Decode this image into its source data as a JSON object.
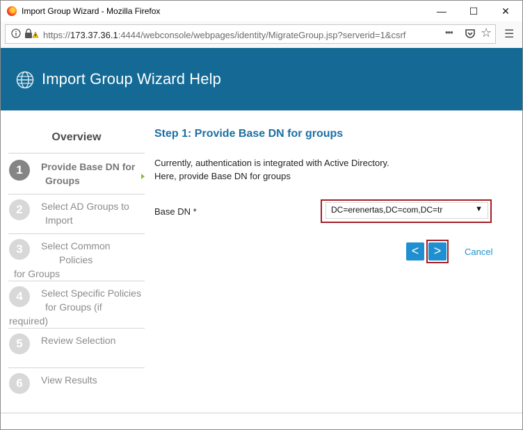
{
  "window": {
    "title": "Import Group Wizard - Mozilla Firefox",
    "controls": {
      "minimize": "—",
      "maximize": "☐",
      "close": "✕"
    }
  },
  "browser": {
    "url_prefix": "https://",
    "url_host": "173.37.36.1",
    "url_rest": ":4444/webconsole/webpages/identity/MigrateGroup.jsp?serverid=1&csrf",
    "page_actions_icon": "•••",
    "pocket_icon": "pocket-icon",
    "bookmark_icon": "☆",
    "menu_icon": "☰"
  },
  "header": {
    "title": "Import Group Wizard Help",
    "background": "#146a94"
  },
  "sidebar": {
    "heading": "Overview",
    "steps": [
      {
        "number": "1",
        "line1": "Provide Base DN for",
        "line2": "Groups",
        "line3": ""
      },
      {
        "number": "2",
        "line1": "Select AD Groups to",
        "line2": "Import",
        "line3": ""
      },
      {
        "number": "3",
        "line1": "Select Common",
        "line2": "Policies",
        "line3": "for Groups"
      },
      {
        "number": "4",
        "line1": "Select Specific Policies",
        "line2": "for Groups (if",
        "line3": "required)"
      },
      {
        "number": "5",
        "line1": "Review Selection",
        "line2": "",
        "line3": ""
      },
      {
        "number": "6",
        "line1": "View Results",
        "line2": "",
        "line3": ""
      }
    ]
  },
  "main": {
    "step_title": "Step 1: Provide Base DN for groups",
    "description_line1": "Currently, authentication is integrated with Active Directory.",
    "description_line2": "Here, provide Base DN for groups",
    "base_dn_label": "Base DN *",
    "base_dn_value": "DC=erenertas,DC=com,DC=tr",
    "back_label": "<",
    "next_label": ">",
    "cancel_label": "Cancel"
  },
  "colors": {
    "accent": "#1e8fd1",
    "highlight_outline": "#a31d24",
    "step_title": "#1b6fa3",
    "active_arrow": "#8bbd3a"
  }
}
